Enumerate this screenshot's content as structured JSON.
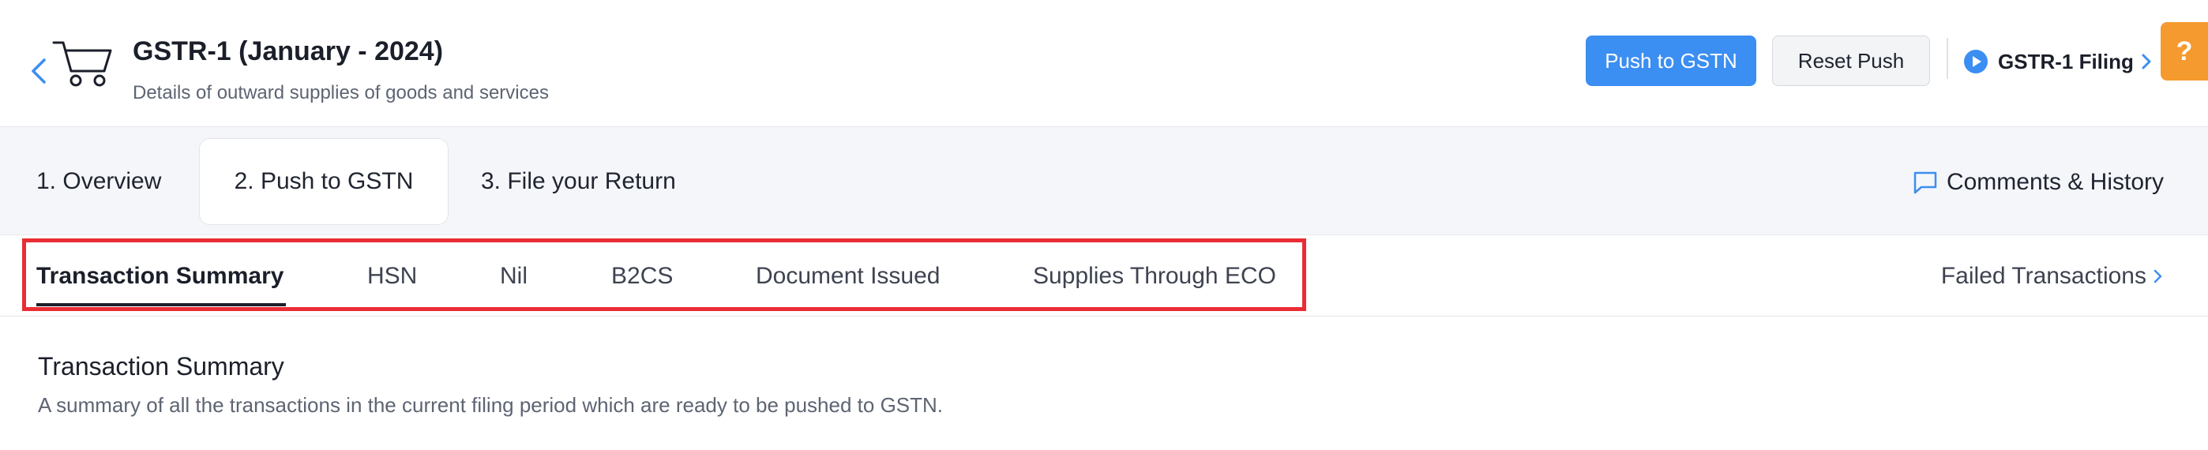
{
  "header": {
    "title": "GSTR-1 (January - 2024)",
    "subtitle": "Details of outward supplies of goods and services",
    "back_icon": "chevron-left-icon",
    "logo_icon": "cart-icon",
    "push_button": "Push to GSTN",
    "reset_button": "Reset Push",
    "filing_link": "GSTR-1 Filing",
    "help_label": "?"
  },
  "steps": [
    {
      "label": "1. Overview",
      "active": false
    },
    {
      "label": "2. Push to GSTN",
      "active": true
    },
    {
      "label": "3. File your Return",
      "active": false
    }
  ],
  "comments_label": "Comments & History",
  "subtabs": [
    {
      "label": "Transaction Summary",
      "active": true
    },
    {
      "label": "HSN",
      "active": false
    },
    {
      "label": "Nil",
      "active": false
    },
    {
      "label": "B2CS",
      "active": false
    },
    {
      "label": "Document Issued",
      "active": false
    },
    {
      "label": "Supplies Through ECO",
      "active": false
    }
  ],
  "failed_transactions_label": "Failed Transactions",
  "section": {
    "title": "Transaction Summary",
    "description": "A summary of all the transactions in the current filing period which are ready to be pushed to GSTN."
  },
  "colors": {
    "accent": "#3b8ef2",
    "help": "#f59a2f",
    "highlight": "#ea2d35"
  }
}
